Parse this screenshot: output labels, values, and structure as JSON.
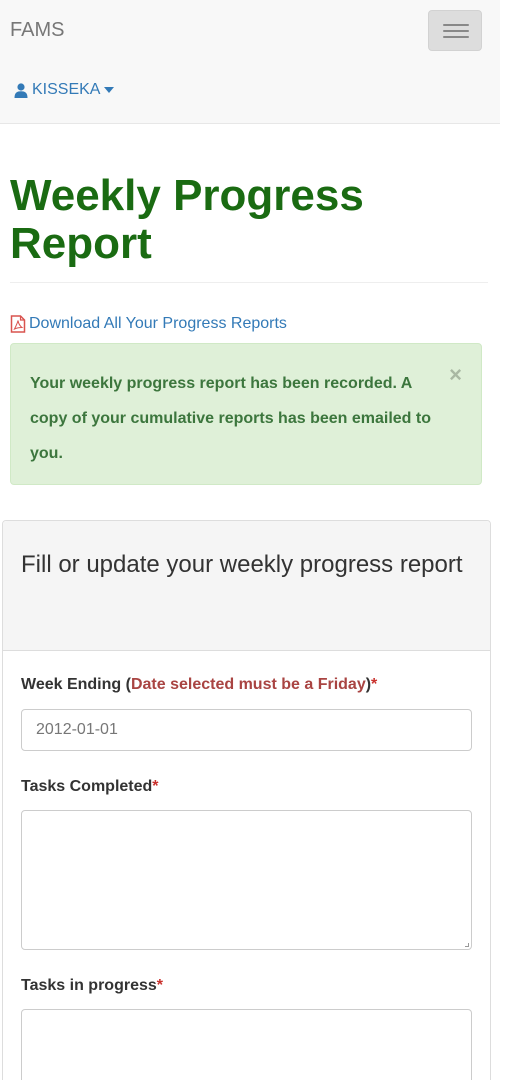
{
  "navbar": {
    "brand": "FAMS",
    "user": "KISSEKA"
  },
  "page": {
    "title": "Weekly Progress Report",
    "download_link": "Download All Your Progress Reports"
  },
  "alert": {
    "message": "Your weekly progress report has been recorded. A copy of your cumulative reports has been emailed to you.",
    "close": "×"
  },
  "form": {
    "heading": "Fill or update your weekly progress report",
    "week_ending": {
      "label": "Week Ending",
      "open_paren": "(",
      "hint": "Date selected must be a Friday",
      "close_paren": ")",
      "required": "*",
      "value": "2012-01-01"
    },
    "tasks_completed": {
      "label": "Tasks Completed",
      "required": "*"
    },
    "tasks_in_progress": {
      "label": "Tasks in progress",
      "required": "*"
    }
  },
  "colors": {
    "title": "#1a6b12",
    "link": "#337ab7",
    "alert_bg": "#dff0d8",
    "alert_text": "#3c763d",
    "required": "#c9302c",
    "hint": "#a94442"
  },
  "icons": [
    "menu-icon",
    "user-icon",
    "caret-down-icon",
    "pdf-file-icon",
    "close-icon"
  ]
}
